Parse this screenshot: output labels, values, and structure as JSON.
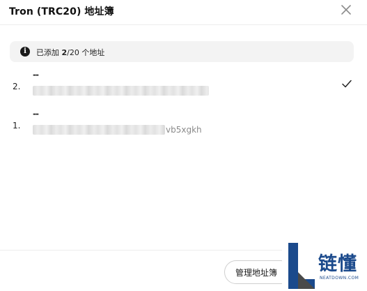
{
  "dialog": {
    "title": "Tron (TRC20) 地址簿",
    "close_icon": "close-icon"
  },
  "info": {
    "icon": "info-icon",
    "prefix": "已添加 ",
    "count": "2",
    "suffix": "/20 个地址"
  },
  "addresses": [
    {
      "index": "2.",
      "label": "--",
      "address_visible": "",
      "selected": true,
      "check_icon": "check-icon"
    },
    {
      "index": "1.",
      "label": "--",
      "address_visible": "vb5xgkh",
      "selected": false
    }
  ],
  "footer": {
    "manage_button": "管理地址簿"
  },
  "watermark": {
    "logo_letter": "L",
    "brand_cn": "链懂",
    "brand_en": "NEATDOWN.COM",
    "colors": {
      "primary": "#1b4a8c",
      "accent": "#4a4a4a"
    }
  }
}
